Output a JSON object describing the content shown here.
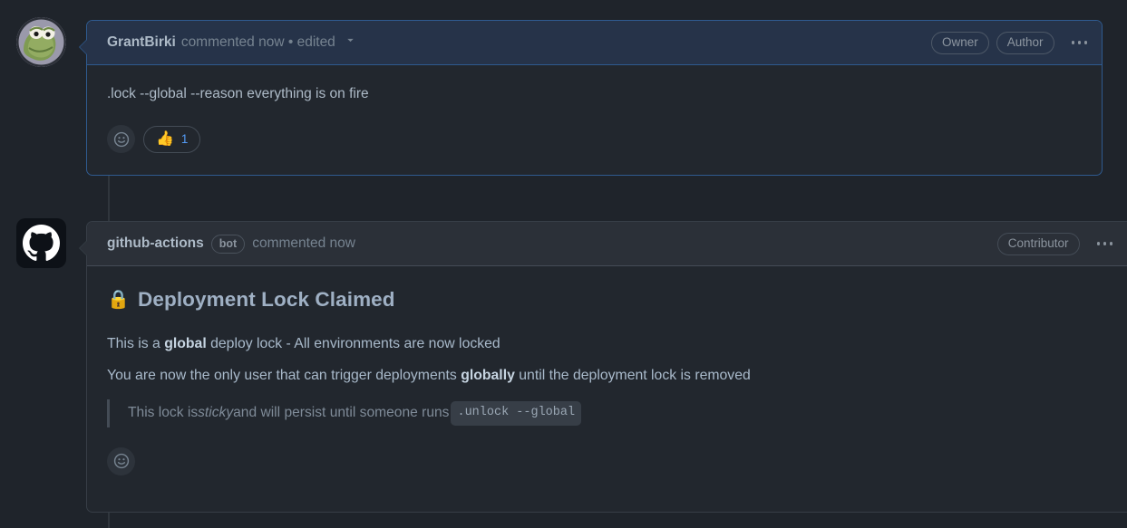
{
  "theme": {
    "page_bg": "#1f242b",
    "card_bg": "#22272e",
    "header_bg_highlight": "#263349",
    "header_bg_default": "#2b3038",
    "border_highlight": "#2f5a8f",
    "border_default": "#373e47",
    "text_primary": "#adbac7",
    "text_muted": "#768390",
    "accent_link": "#539bf5"
  },
  "comments": [
    {
      "id": "comment-grantbirki",
      "avatar": {
        "name": "kermit-avatar",
        "alt": "GrantBirki avatar"
      },
      "author": "GrantBirki",
      "meta": "commented now • edited",
      "edited_dropdown_icon": "chevron-down-icon",
      "badges": [
        "Owner",
        "Author"
      ],
      "menu_icon": "kebab-horizontal-icon",
      "body_text": ".lock --global --reason everything is on fire",
      "reactions": {
        "add_icon": "smiley-add-reaction-icon",
        "items": [
          {
            "emoji": "👍",
            "name": "thumbs-up-reaction",
            "count": "1"
          }
        ]
      }
    },
    {
      "id": "comment-github-actions",
      "avatar": {
        "name": "github-octocat-avatar",
        "alt": "github-actions avatar"
      },
      "author": "github-actions",
      "bot_pill": "bot",
      "meta": "commented now",
      "badges": [
        "Contributor"
      ],
      "menu_icon": "kebab-horizontal-icon",
      "heading": {
        "emoji": "🔒",
        "emoji_name": "lock-emoji",
        "text": "Deployment Lock Claimed"
      },
      "paragraphs": [
        {
          "parts": [
            {
              "type": "text",
              "value": "This is a "
            },
            {
              "type": "bold",
              "value": "global"
            },
            {
              "type": "text",
              "value": " deploy lock - All environments are now locked"
            }
          ]
        },
        {
          "parts": [
            {
              "type": "text",
              "value": "You are now the only user that can trigger deployments "
            },
            {
              "type": "bold",
              "value": "globally"
            },
            {
              "type": "text",
              "value": " until the deployment lock is removed"
            }
          ]
        }
      ],
      "quote": {
        "prefix": "This lock is ",
        "italic": "sticky",
        "middle": " and will persist until someone runs ",
        "code": ".unlock --global"
      },
      "reactions": {
        "add_icon": "smiley-add-reaction-icon",
        "items": []
      }
    }
  ]
}
